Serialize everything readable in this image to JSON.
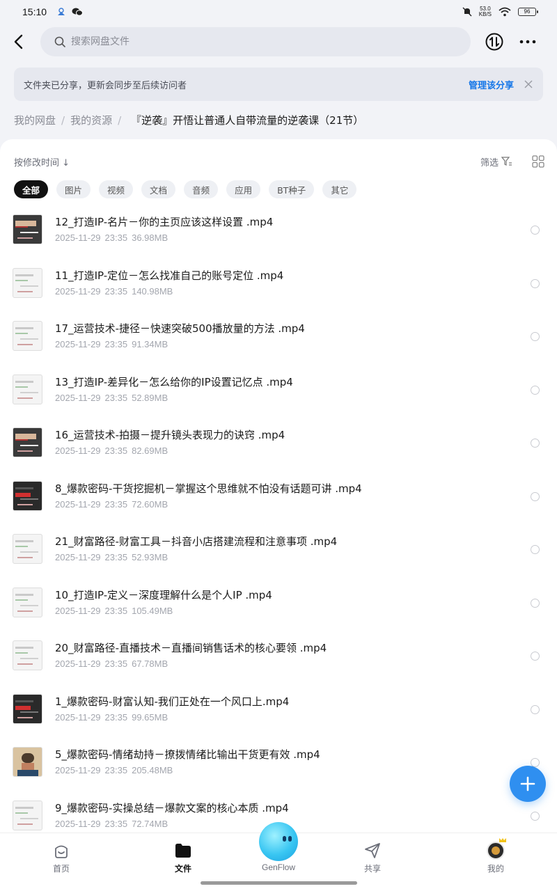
{
  "status": {
    "time": "15:10",
    "net_speed_value": "53.0",
    "net_speed_unit": "KB/S",
    "battery": "96"
  },
  "header": {
    "search_placeholder": "搜索网盘文件"
  },
  "banner": {
    "text": "文件夹已分享，更新会同步至后续访问者",
    "action": "管理该分享"
  },
  "breadcrumb": {
    "items": [
      "我的网盘",
      "我的资源"
    ],
    "current": "『逆袭』开悟让普通人自带流量的逆袭课（21节）"
  },
  "sort": {
    "label": "按修改时间 ↓",
    "filter_label": "筛选"
  },
  "chips": [
    "全部",
    "图片",
    "视频",
    "文档",
    "音频",
    "应用",
    "BT种子",
    "其它"
  ],
  "files": [
    {
      "name": "12_打造IP-名片－你的主页应该这样设置 .mp4",
      "date": "2025-11-29",
      "time": "23:35",
      "size": "36.98MB",
      "thumb": "photo"
    },
    {
      "name": "11_打造IP-定位－怎么找准自己的账号定位 .mp4",
      "date": "2025-11-29",
      "time": "23:35",
      "size": "140.98MB",
      "thumb": "doc"
    },
    {
      "name": "17_运营技术-捷径－快速突破500播放量的方法 .mp4",
      "date": "2025-11-29",
      "time": "23:35",
      "size": "91.34MB",
      "thumb": "doc"
    },
    {
      "name": "13_打造IP-差异化－怎么给你的IP设置记忆点 .mp4",
      "date": "2025-11-29",
      "time": "23:35",
      "size": "52.89MB",
      "thumb": "doc"
    },
    {
      "name": "16_运营技术-拍摄－提升镜头表现力的诀窍 .mp4",
      "date": "2025-11-29",
      "time": "23:35",
      "size": "82.69MB",
      "thumb": "photo"
    },
    {
      "name": "8_爆款密码-干货挖掘机－掌握这个思维就不怕没有话题可讲 .mp4",
      "date": "2025-11-29",
      "time": "23:35",
      "size": "72.60MB",
      "thumb": "dark"
    },
    {
      "name": "21_财富路径-财富工具－抖音小店搭建流程和注意事项 .mp4",
      "date": "2025-11-29",
      "time": "23:35",
      "size": "52.93MB",
      "thumb": "doc"
    },
    {
      "name": "10_打造IP-定义－深度理解什么是个人IP .mp4",
      "date": "2025-11-29",
      "time": "23:35",
      "size": "105.49MB",
      "thumb": "doc"
    },
    {
      "name": "20_财富路径-直播技术－直播间销售话术的核心要领 .mp4",
      "date": "2025-11-29",
      "time": "23:35",
      "size": "67.78MB",
      "thumb": "doc"
    },
    {
      "name": "1_爆款密码-财富认知-我们正处在一个风口上.mp4",
      "date": "2025-11-29",
      "time": "23:35",
      "size": "99.65MB",
      "thumb": "dark"
    },
    {
      "name": "5_爆款密码-情绪劫持－撩拨情绪比输出干货更有效 .mp4",
      "date": "2025-11-29",
      "time": "23:35",
      "size": "205.48MB",
      "thumb": "face"
    },
    {
      "name": "9_爆款密码-实操总结－爆款文案的核心本质 .mp4",
      "date": "2025-11-29",
      "time": "23:35",
      "size": "72.74MB",
      "thumb": "doc"
    }
  ],
  "tabs": {
    "home": "首页",
    "files": "文件",
    "genflow": "GenFlow",
    "share": "共享",
    "mine": "我的"
  },
  "colors": {
    "accent": "#1677e8",
    "fab": "#2f8ff0",
    "active_chip": "#111111"
  }
}
